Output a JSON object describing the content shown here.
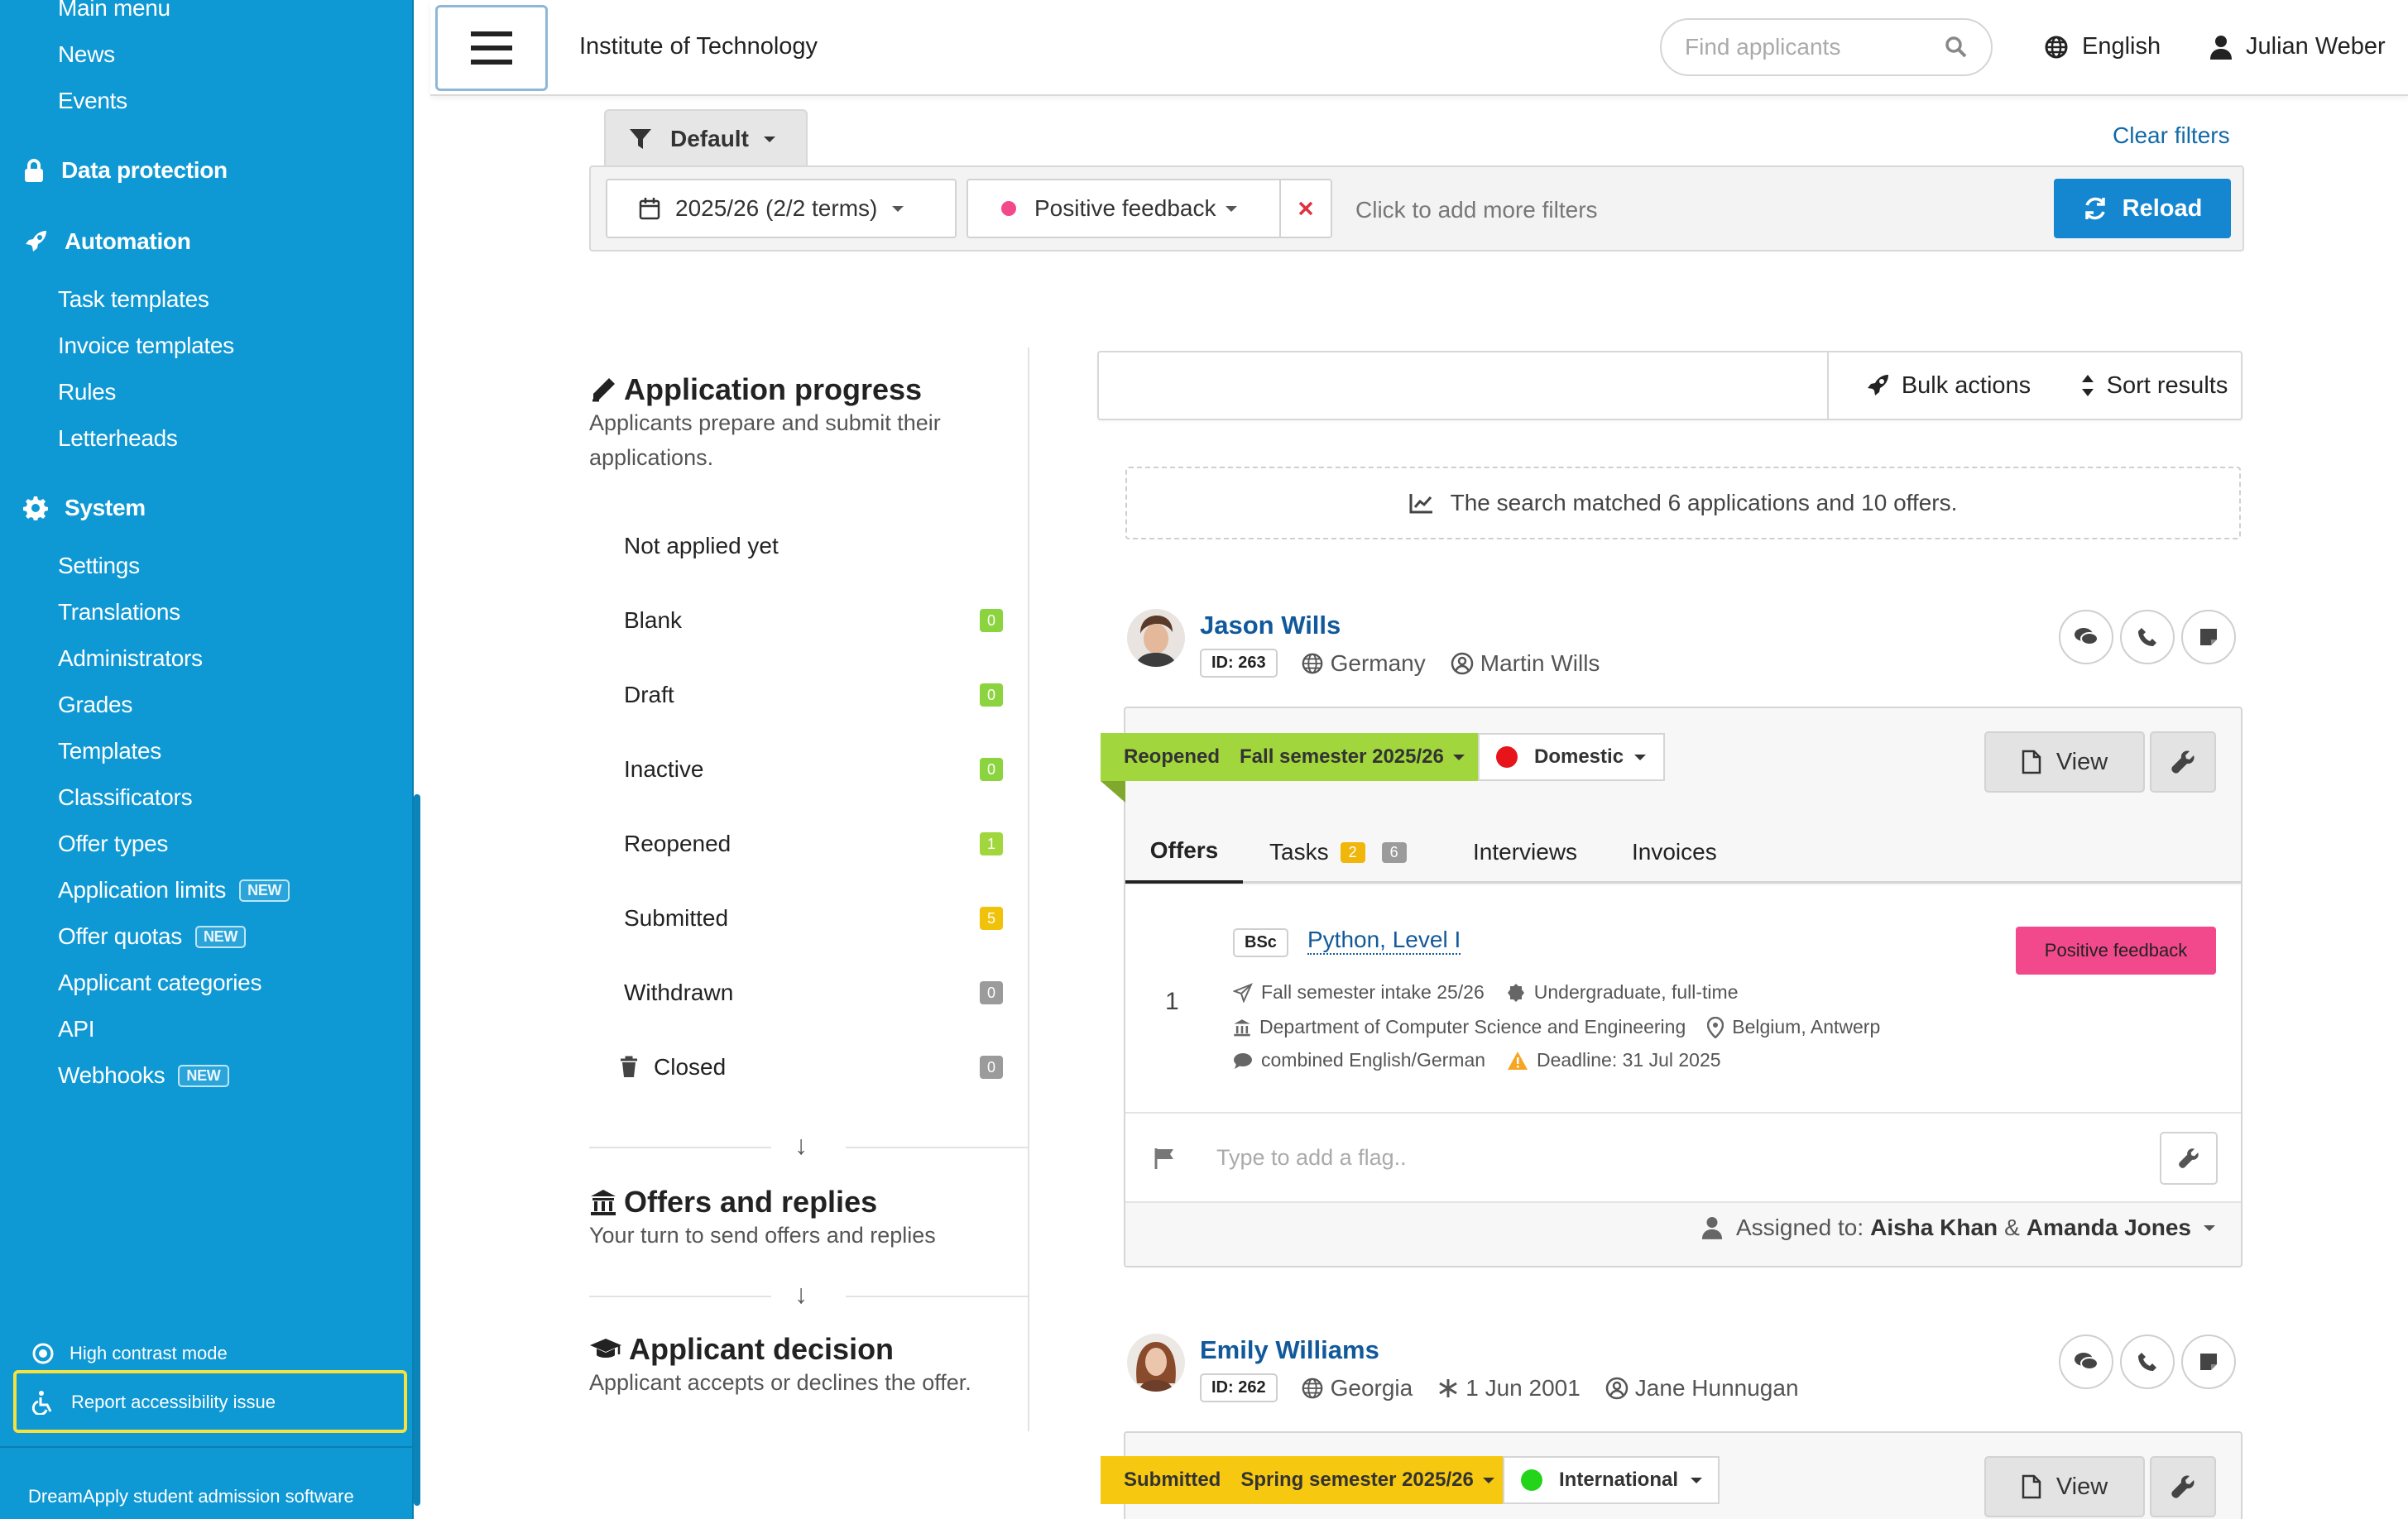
{
  "sidebar": {
    "items_top": [
      "Main menu",
      "News",
      "Events"
    ],
    "data_protection": "Data protection",
    "automation": "Automation",
    "automation_items": [
      "Task templates",
      "Invoice templates",
      "Rules",
      "Letterheads"
    ],
    "system": "System",
    "system_items": [
      "Settings",
      "Translations",
      "Administrators",
      "Grades",
      "Templates",
      "Classificators",
      "Offer types",
      "Application limits",
      "Offer quotas",
      "Applicant categories",
      "API",
      "Webhooks"
    ],
    "new_badge": "NEW",
    "high_contrast": "High contrast mode",
    "report_a11y": "Report accessibility issue",
    "brand": "DreamApply student admission software",
    "accent": "#0e98d4"
  },
  "topbar": {
    "institution": "Institute of Technology",
    "search_placeholder": "Find applicants",
    "language": "English",
    "user": "Julian Weber"
  },
  "filters": {
    "preset": "Default",
    "clear": "Clear filters",
    "term": "2025/26 (2/2 terms)",
    "feedback": "Positive feedback",
    "more": "Click to add more filters",
    "reload": "Reload"
  },
  "progress": {
    "title": "Application progress",
    "subtitle1": "Applicants prepare and submit their",
    "subtitle2": "applications.",
    "rows": [
      {
        "label": "Not applied yet",
        "count": ""
      },
      {
        "label": "Blank",
        "count": "0"
      },
      {
        "label": "Draft",
        "count": "0"
      },
      {
        "label": "Inactive",
        "count": "0"
      },
      {
        "label": "Reopened",
        "count": "1"
      },
      {
        "label": "Submitted",
        "count": "5"
      },
      {
        "label": "Withdrawn",
        "count": "0"
      },
      {
        "label": "Closed",
        "count": "0"
      }
    ],
    "offers_title": "Offers and replies",
    "offers_sub": "Your turn to send offers and replies",
    "decision_title": "Applicant decision",
    "decision_sub": "Applicant accepts or declines the offer."
  },
  "results": {
    "bulk": "Bulk actions",
    "sort": "Sort results",
    "matched": "The search matched 6 applications and 10 offers."
  },
  "applicants": [
    {
      "name": "Jason Wills",
      "id": "ID: 263",
      "country": "Germany",
      "contact": "Martin Wills",
      "stage": "Reopened",
      "semester": "Fall semester 2025/26",
      "category": "Domestic",
      "category_color": "#e8141c",
      "stage_color": "#a1d63c",
      "view": "View",
      "tabs": {
        "offers": "Offers",
        "tasks": "Tasks",
        "tasks_a": "2",
        "tasks_b": "6",
        "interviews": "Interviews",
        "invoices": "Invoices"
      },
      "offer": {
        "num": "1",
        "level": "BSc",
        "title": "Python, Level I",
        "intake": "Fall semester intake 25/26",
        "type": "Undergraduate, full-time",
        "dept": "Department of Computer Science and Engineering",
        "location": "Belgium, Antwerp",
        "language": "combined English/German",
        "deadline": "Deadline: 31 Jul 2025",
        "status": "Positive feedback"
      },
      "flag_placeholder": "Type to add a flag..",
      "assigned_label": "Assigned to:",
      "assigned_a": "Aisha Khan",
      "assigned_amp": "&",
      "assigned_b": "Amanda Jones"
    },
    {
      "name": "Emily Williams",
      "id": "ID: 262",
      "country": "Georgia",
      "birth": "1 Jun 2001",
      "contact": "Jane Hunnugan",
      "stage": "Submitted",
      "semester": "Spring semester 2025/26",
      "category": "International",
      "category_color": "#23d41a",
      "stage_color": "#f6c80f",
      "view": "View"
    }
  ]
}
